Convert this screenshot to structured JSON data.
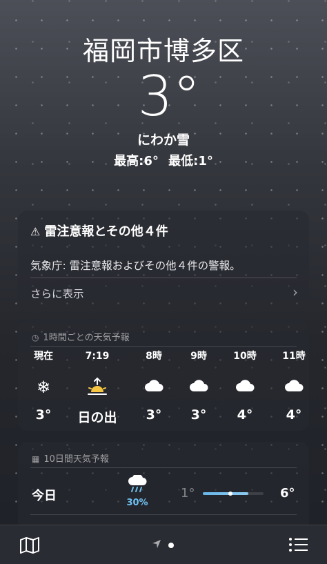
{
  "location": {
    "city": "福岡市博多区",
    "temperature": "3°",
    "condition": "にわか雪",
    "high": "最高:6°",
    "low": "最低:1°"
  },
  "alert": {
    "icon": "warning-triangle-icon",
    "title": "雷注意報とその他４件",
    "body": "気象庁: 雷注意報およびその他４件の警報。",
    "more": "さらに表示",
    "chevron": "›"
  },
  "hourly": {
    "header": "1時間ごとの天気予報",
    "icon": "clock-icon",
    "items": [
      {
        "label": "現在",
        "icon": "snowflake-icon",
        "glyph": "❄",
        "value": "3°"
      },
      {
        "label": "7:19",
        "icon": "sunrise-icon",
        "glyph": "",
        "value": "日の出"
      },
      {
        "label": "8時",
        "icon": "cloud-icon",
        "glyph": "",
        "value": "3°"
      },
      {
        "label": "9時",
        "icon": "cloud-icon",
        "glyph": "",
        "value": "3°"
      },
      {
        "label": "10時",
        "icon": "cloud-icon",
        "glyph": "",
        "value": "4°"
      },
      {
        "label": "11時",
        "icon": "cloud-icon",
        "glyph": "",
        "value": "4°"
      }
    ]
  },
  "daily": {
    "header": "10日間天気予報",
    "icon": "calendar-icon",
    "rows": [
      {
        "day": "今日",
        "icon": "cloud-rain-icon",
        "precip": "30%",
        "low": "1°",
        "high": "6°",
        "range_fill": [
          0.0,
          0.75
        ],
        "current_marker": 0.45
      }
    ]
  },
  "toolbar": {
    "map_icon": "map-icon",
    "location_icon": "location-arrow-icon",
    "list_icon": "list-icon"
  },
  "colors": {
    "accent_precip": "#6fc1f0",
    "sunrise": "#f5c542"
  }
}
